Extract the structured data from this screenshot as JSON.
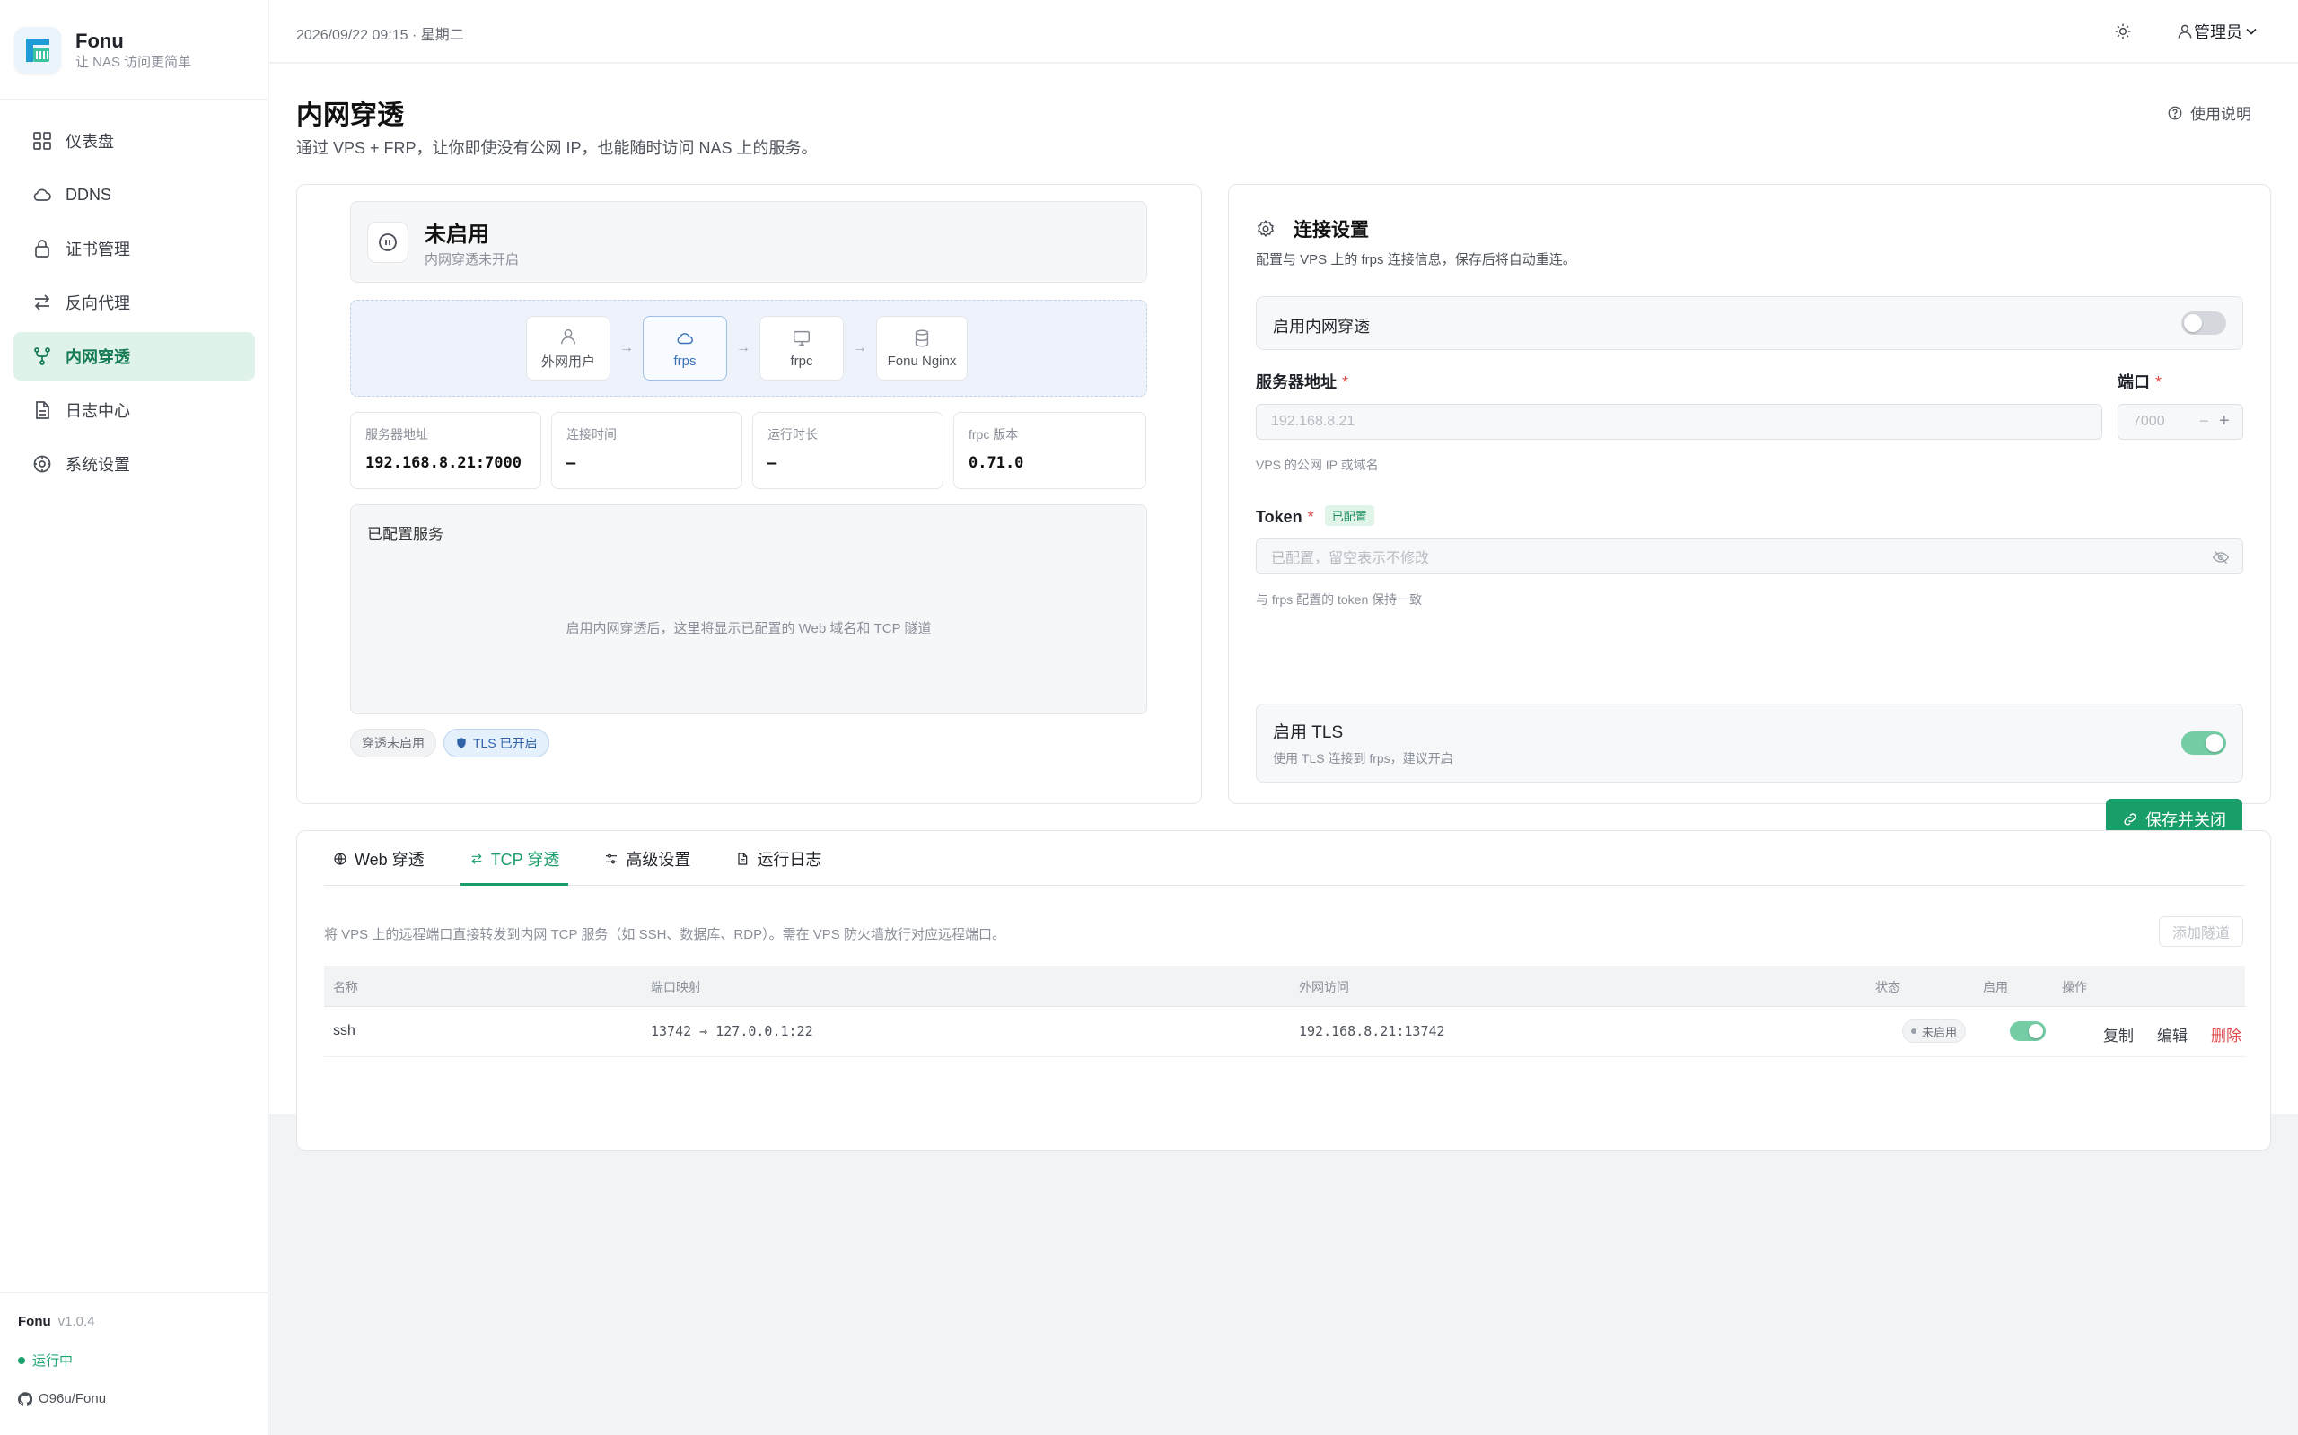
{
  "app": {
    "name": "Fonu",
    "tagline": "让 NAS 访问更简单",
    "version": "v1.0.4",
    "running": "运行中",
    "repo": "O96u/Fonu"
  },
  "header": {
    "datetime": "2026/09/22 09:15 · 星期二",
    "user": "管理员"
  },
  "sidebar": {
    "items": [
      {
        "label": "仪表盘",
        "icon": "dashboard-icon"
      },
      {
        "label": "DDNS",
        "icon": "cloud-icon"
      },
      {
        "label": "证书管理",
        "icon": "lock-icon"
      },
      {
        "label": "反向代理",
        "icon": "swap-icon"
      },
      {
        "label": "内网穿透",
        "icon": "branch-icon",
        "active": true
      },
      {
        "label": "日志中心",
        "icon": "document-icon"
      },
      {
        "label": "系统设置",
        "icon": "settings-icon"
      }
    ]
  },
  "page": {
    "title": "内网穿透",
    "description": "通过 VPS + FRP，让你即使没有公网 IP，也能随时访问 NAS 上的服务。",
    "help": "使用说明"
  },
  "status": {
    "title": "未启用",
    "subtitle": "内网穿透未开启"
  },
  "flow": {
    "nodes": [
      "外网用户",
      "frps",
      "frpc",
      "Fonu Nginx"
    ],
    "arrow": "→"
  },
  "stats": [
    {
      "label": "服务器地址",
      "value": "192.168.8.21:7000"
    },
    {
      "label": "连接时间",
      "value": "—"
    },
    {
      "label": "运行时长",
      "value": "—"
    },
    {
      "label": "frpc 版本",
      "value": "0.71.0"
    }
  ],
  "services": {
    "title": "已配置服务",
    "empty": "启用内网穿透后，这里将显示已配置的 Web 域名和 TCP 隧道"
  },
  "chips": {
    "tunnel": "穿透未启用",
    "tls": "TLS 已开启"
  },
  "settings": {
    "title": "连接设置",
    "description": "配置与 VPS 上的 frps 连接信息，保存后将自动重连。",
    "enable_label": "启用内网穿透",
    "enable_on": false,
    "server_label": "服务器地址",
    "server_placeholder": "192.168.8.21",
    "server_hint": "VPS 的公网 IP 或域名",
    "port_label": "端口",
    "port_placeholder": "7000",
    "required": "*",
    "token_label": "Token",
    "token_badge": "已配置",
    "token_placeholder": "已配置，留空表示不修改",
    "token_hint": "与 frps 配置的 token 保持一致",
    "tls_title": "启用 TLS",
    "tls_desc": "使用 TLS 连接到 frps，建议开启",
    "tls_on": true,
    "save": "保存并关闭"
  },
  "tabs": [
    {
      "label": "Web 穿透",
      "icon": "globe-icon"
    },
    {
      "label": "TCP 穿透",
      "icon": "swap-icon",
      "active": true
    },
    {
      "label": "高级设置",
      "icon": "sliders-icon"
    },
    {
      "label": "运行日志",
      "icon": "document-icon"
    }
  ],
  "tcp": {
    "description": "将 VPS 上的远程端口直接转发到内网 TCP 服务（如 SSH、数据库、RDP）。需在 VPS 防火墙放行对应远程端口。",
    "add": "添加隧道",
    "columns": [
      "名称",
      "端口映射",
      "外网访问",
      "状态",
      "启用",
      "操作"
    ],
    "rows": [
      {
        "name": "ssh",
        "mapping": "13742 → 127.0.0.1:22",
        "access": "192.168.8.21:13742",
        "status": "未启用",
        "enabled": true,
        "actions": [
          "复制",
          "编辑",
          "删除"
        ]
      }
    ]
  },
  "colors": {
    "accent": "#199e6a",
    "danger": "#e04a4a",
    "tls_chip": "#2f63a7"
  }
}
